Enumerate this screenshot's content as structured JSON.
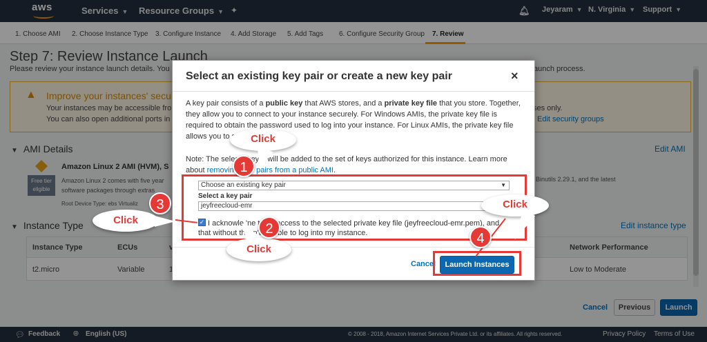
{
  "nav": {
    "logo": "aws",
    "services": "Services",
    "resource_groups": "Resource Groups",
    "user": "Jeyaram",
    "region": "N. Virginia",
    "support": "Support"
  },
  "steps": [
    "1. Choose AMI",
    "2. Choose Instance Type",
    "3. Configure Instance",
    "4. Add Storage",
    "5. Add Tags",
    "6. Configure Security Group",
    "7. Review"
  ],
  "page": {
    "title": "Step 7: Review Instance Launch",
    "subtitle": "Please review your instance launch details. You ca",
    "subtitle_end": "aunch process."
  },
  "warning": {
    "title": "Improve your instances' securi",
    "line1": "Your instances may be accessible from",
    "line2": "You can also open additional ports in yo",
    "line1_end": "ses only.",
    "edit_link": "Edit security groups"
  },
  "ami_section": {
    "title": "AMI Details",
    "edit": "Edit AMI",
    "name": "Amazon Linux 2 AMI (HVM), S",
    "free_badge_line1": "Free tier",
    "free_badge_line2": "eligible",
    "desc_line1": "Amazon Linux 2 comes with five year",
    "desc_line2": "software packages through extras",
    "desc_end": "Binutils 2.29.1, and the latest",
    "root_device": "Root Device Type: ebs    Virtualiz"
  },
  "instance_section": {
    "title": "Instance Type",
    "edit": "Edit instance type",
    "headers": [
      "Instance Type",
      "ECUs",
      "v",
      "Network Performance"
    ],
    "row": [
      "t2.micro",
      "Variable",
      "1",
      "Low to Moderate"
    ]
  },
  "footer_buttons": {
    "cancel": "Cancel",
    "previous": "Previous",
    "launch": "Launch"
  },
  "bottombar": {
    "feedback": "Feedback",
    "language": "English (US)",
    "copyright": "© 2008 - 2018, Amazon Internet Services Private Ltd. or its affiliates. All rights reserved.",
    "privacy": "Privacy Policy",
    "terms": "Terms of Use"
  },
  "modal": {
    "title": "Select an existing key pair or create a new key pair",
    "close": "×",
    "desc_p1": "A key pair consists of a ",
    "desc_b1": "public key",
    "desc_p2": " that AWS stores, and a ",
    "desc_b2": "private key file",
    "desc_p3": " that you store. Together, they allow you to connect to your instance securely. For Windows AMIs, the private key file is required to obtain the password used to log into your instance. For Linux AMIs, the private key file allows you to securely SSH i",
    "note_text": "Note: The selecte    key p    will be added to the set of keys authorized for this instance. Learn more about ",
    "note_link": "removin      ir    key pairs from a public AMI",
    "note_end": ".",
    "select_value": "Choose an existing key pair",
    "keypair_label": "Select a key pair",
    "keypair_value": "jeyfreecloud-emr",
    "ack_text": "I acknowle  'ne t    ave access to the selected private key file (jeyfreecloud-emr.pem), and",
    "ack_text2": "that without this      n't be able to log into my instance.",
    "cancel": "Cancel",
    "launch": "Launch Instances"
  },
  "annotations": {
    "callouts": [
      "Click",
      "Click",
      "Click",
      "Click"
    ],
    "numbers": [
      "1",
      "2",
      "3",
      "4"
    ]
  }
}
